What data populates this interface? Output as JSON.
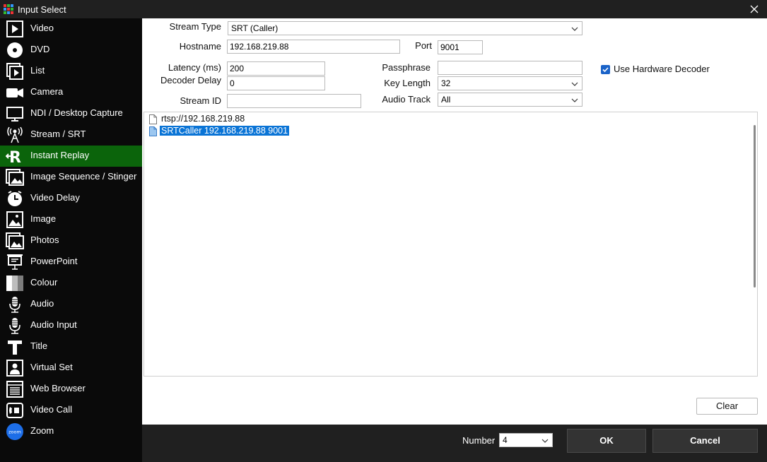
{
  "window": {
    "title": "Input Select",
    "icon": "grid-app-icon",
    "close_icon": "close-icon"
  },
  "sidebar": {
    "selected_index": 6,
    "selected_color": "#0b640b",
    "items": [
      {
        "label": "Video",
        "icon": "video-icon"
      },
      {
        "label": "DVD",
        "icon": "dvd-icon"
      },
      {
        "label": "List",
        "icon": "list-icon"
      },
      {
        "label": "Camera",
        "icon": "camera-icon"
      },
      {
        "label": "NDI / Desktop Capture",
        "icon": "monitor-icon"
      },
      {
        "label": "Stream / SRT",
        "icon": "antenna-icon"
      },
      {
        "label": "Instant Replay",
        "icon": "replay-icon"
      },
      {
        "label": "Image Sequence / Stinger",
        "icon": "image-sequence-icon"
      },
      {
        "label": "Video Delay",
        "icon": "clock-icon"
      },
      {
        "label": "Image",
        "icon": "image-icon"
      },
      {
        "label": "Photos",
        "icon": "photos-icon"
      },
      {
        "label": "PowerPoint",
        "icon": "presentation-icon"
      },
      {
        "label": "Colour",
        "icon": "colour-icon"
      },
      {
        "label": "Audio",
        "icon": "microphone-icon"
      },
      {
        "label": "Audio Input",
        "icon": "microphone-icon"
      },
      {
        "label": "Title",
        "icon": "title-icon"
      },
      {
        "label": "Virtual Set",
        "icon": "virtual-set-icon"
      },
      {
        "label": "Web Browser",
        "icon": "web-browser-icon"
      },
      {
        "label": "Video Call",
        "icon": "video-call-icon"
      },
      {
        "label": "Zoom",
        "icon": "zoom-icon",
        "icon_text": "zoom"
      }
    ]
  },
  "form": {
    "stream_type": {
      "label": "Stream Type",
      "value": "SRT (Caller)"
    },
    "hostname": {
      "label": "Hostname",
      "value": "192.168.219.88"
    },
    "port": {
      "label": "Port",
      "value": "9001"
    },
    "latency": {
      "label": "Latency (ms)",
      "value": "200"
    },
    "decoder_delay": {
      "label": "Decoder Delay",
      "value": "0"
    },
    "stream_id": {
      "label": "Stream ID",
      "value": ""
    },
    "passphrase": {
      "label": "Passphrase",
      "value": ""
    },
    "key_length": {
      "label": "Key Length",
      "value": "32"
    },
    "audio_track": {
      "label": "Audio Track",
      "value": "All"
    },
    "hardware_decoder": {
      "label": "Use Hardware Decoder",
      "checked": true
    }
  },
  "history": {
    "items": [
      {
        "text": "rtsp://192.168.219.88",
        "selected": false
      },
      {
        "text": "SRTCaller 192.168.219.88 9001",
        "selected": true
      }
    ]
  },
  "buttons": {
    "clear": "Clear",
    "ok": "OK",
    "cancel": "Cancel"
  },
  "footer": {
    "number_label": "Number",
    "number_value": "4"
  }
}
